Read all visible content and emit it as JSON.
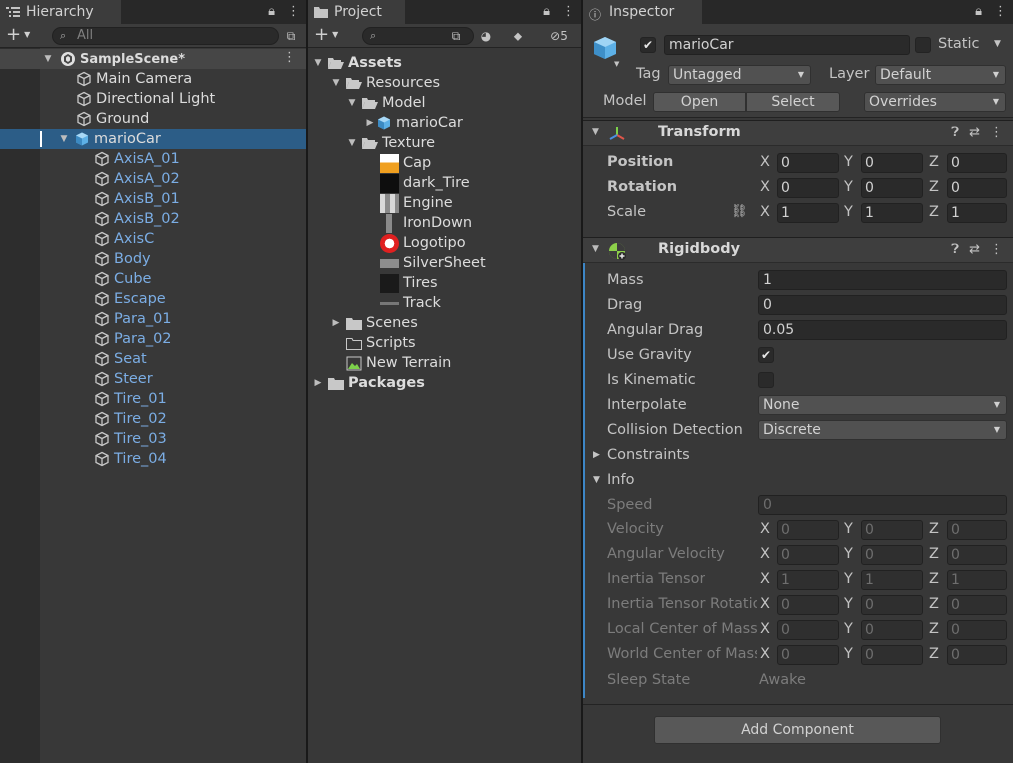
{
  "hierarchy": {
    "tab_label": "Hierarchy",
    "search_placeholder": "All",
    "scene_name": "SampleScene*",
    "root_items": [
      "Main Camera",
      "Directional Light",
      "Ground"
    ],
    "selected": "marioCar",
    "children": [
      "AxisA_01",
      "AxisA_02",
      "AxisB_01",
      "AxisB_02",
      "AxisC",
      "Body",
      "Cube",
      "Escape",
      "Para_01",
      "Para_02",
      "Seat",
      "Steer",
      "Tire_01",
      "Tire_02",
      "Tire_03",
      "Tire_04"
    ]
  },
  "project": {
    "tab_label": "Project",
    "hidden_count": "5",
    "assets_label": "Assets",
    "resources_label": "Resources",
    "model_label": "Model",
    "model_item": "marioCar",
    "texture_label": "Texture",
    "textures": [
      "Cap",
      "dark_Tire",
      "Engine",
      "IronDown",
      "Logotipo",
      "SilverSheet",
      "Tires",
      "Track"
    ],
    "scenes_label": "Scenes",
    "scripts_label": "Scripts",
    "terrain_label": "New Terrain",
    "packages_label": "Packages"
  },
  "inspector": {
    "tab_label": "Inspector",
    "object_name": "marioCar",
    "static_label": "Static",
    "tag_label": "Tag",
    "tag_value": "Untagged",
    "layer_label": "Layer",
    "layer_value": "Default",
    "model_label": "Model",
    "open_label": "Open",
    "select_label": "Select",
    "overrides_label": "Overrides",
    "transform": {
      "title": "Transform",
      "position_label": "Position",
      "rotation_label": "Rotation",
      "scale_label": "Scale",
      "position": [
        "0",
        "0",
        "0"
      ],
      "rotation": [
        "0",
        "0",
        "0"
      ],
      "scale": [
        "1",
        "1",
        "1"
      ]
    },
    "rigidbody": {
      "title": "Rigidbody",
      "mass_label": "Mass",
      "mass": "1",
      "drag_label": "Drag",
      "drag": "0",
      "angular_drag_label": "Angular Drag",
      "angular_drag": "0.05",
      "use_gravity_label": "Use Gravity",
      "is_kinematic_label": "Is Kinematic",
      "interpolate_label": "Interpolate",
      "interpolate": "None",
      "collision_label": "Collision Detection",
      "collision": "Discrete",
      "constraints_label": "Constraints",
      "info_label": "Info",
      "speed_label": "Speed",
      "speed": "0",
      "velocity_label": "Velocity",
      "velocity": [
        "0",
        "0",
        "0"
      ],
      "angular_velocity_label": "Angular Velocity",
      "angular_velocity": [
        "0",
        "0",
        "0"
      ],
      "inertia_tensor_label": "Inertia Tensor",
      "inertia_tensor": [
        "1",
        "1",
        "1"
      ],
      "inertia_rot_label": "Inertia Tensor Rotatio",
      "inertia_rot": [
        "0",
        "0",
        "0"
      ],
      "local_com_label": "Local Center of Mass",
      "local_com": [
        "0",
        "0",
        "0"
      ],
      "world_com_label": "World Center of Mass",
      "world_com": [
        "0",
        "0",
        "0"
      ],
      "sleep_label": "Sleep State",
      "sleep": "Awake"
    },
    "add_component_label": "Add Component"
  },
  "axes": {
    "x": "X",
    "y": "Y",
    "z": "Z"
  },
  "colors": {
    "selection": "#2c5d87",
    "child_text": "#7bade4",
    "panel_bg": "#383838",
    "accent": "#3d86c6"
  }
}
